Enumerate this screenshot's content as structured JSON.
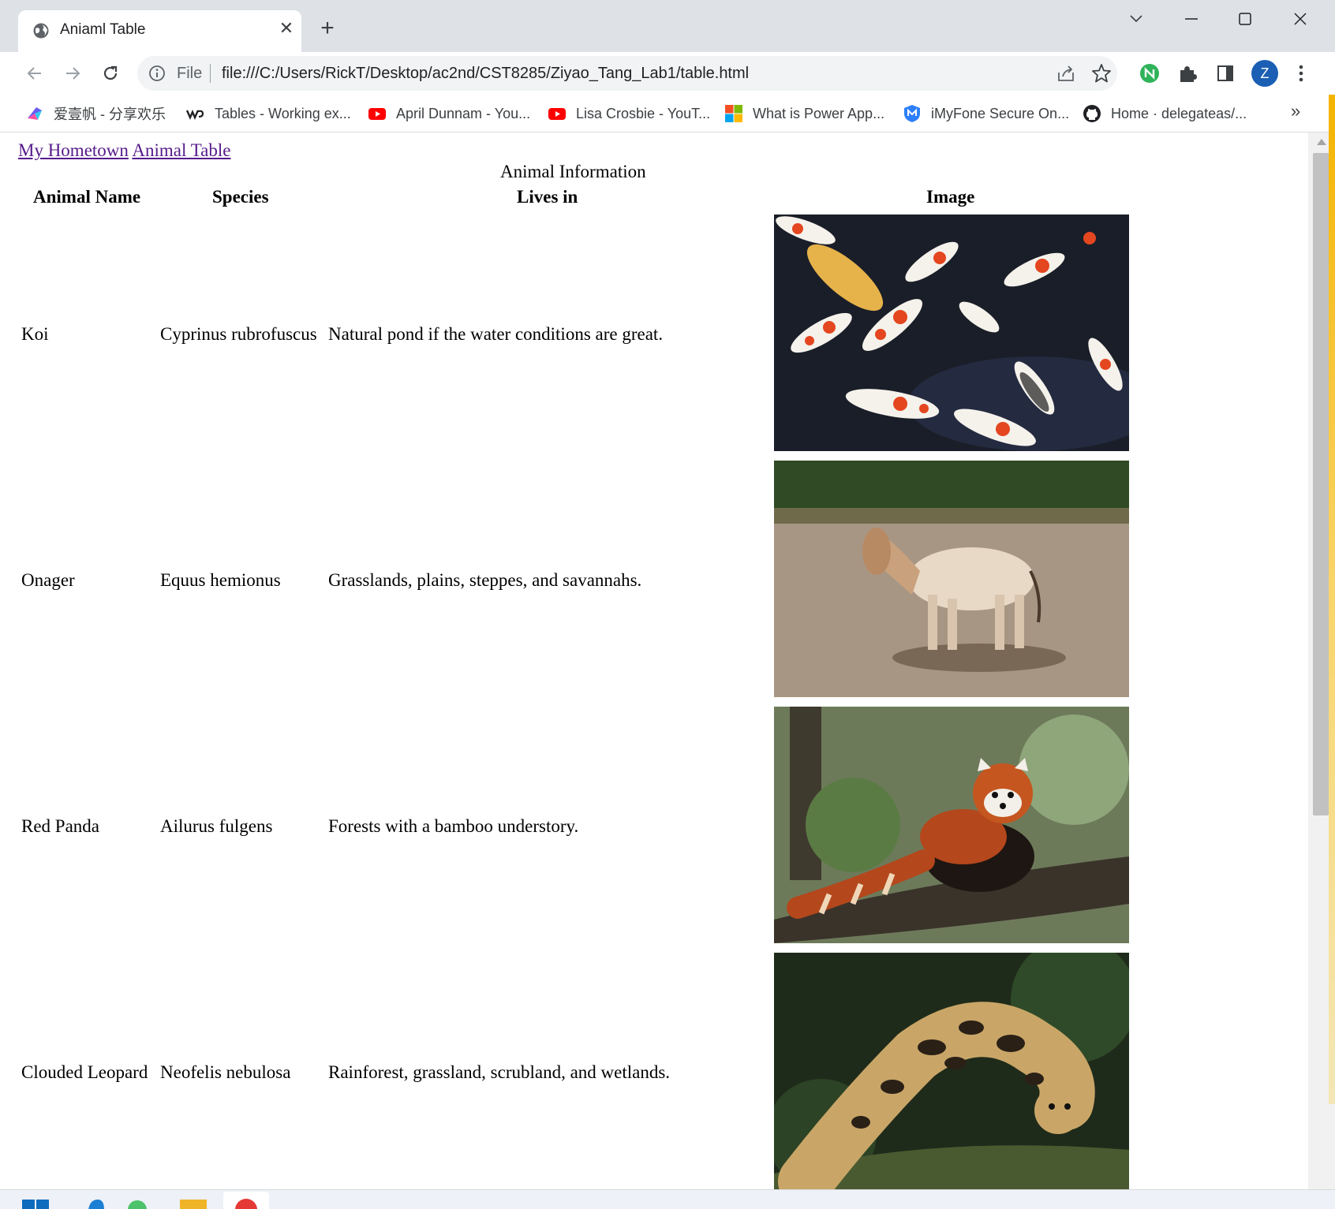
{
  "browser": {
    "tab_title": "Aniaml Table",
    "tab_close": "✕",
    "new_tab": "+",
    "scheme_label": "File",
    "url": "file:///C:/Users/RickT/Desktop/ac2nd/CST8285/Ziyao_Tang_Lab1/table.html",
    "avatar_letter": "Z",
    "bookmarks": [
      "爱壹帆 - 分享欢乐",
      "Tables - Working ex...",
      "April Dunnam - You...",
      "Lisa Crosbie - YouT...",
      "What is Power App...",
      "iMyFone Secure On...",
      "Home · delegateas/..."
    ],
    "bookmarks_more": "»"
  },
  "page": {
    "links": [
      "My Hometown",
      "Animal Table"
    ],
    "caption": "Animal Information",
    "headers": [
      "Animal Name",
      "Species",
      "Lives in",
      "Image"
    ],
    "rows": [
      {
        "name": "Koi",
        "species": "Cyprinus rubrofuscus",
        "lives_in": "Natural pond if the water conditions are great."
      },
      {
        "name": "Onager",
        "species": "Equus hemionus",
        "lives_in": "Grasslands, plains, steppes, and savannahs."
      },
      {
        "name": "Red Panda",
        "species": "Ailurus fulgens",
        "lives_in": "Forests with a bamboo understory."
      },
      {
        "name": "Clouded Leopard",
        "species": "Neofelis nebulosa",
        "lives_in": "Rainforest, grassland, scrubland, and wetlands."
      }
    ]
  },
  "colors": {
    "visited_link": "#551a8b",
    "titlebar": "#dee1e6",
    "omnibox": "#f1f3f4",
    "avatar": "#1a5fb4"
  }
}
